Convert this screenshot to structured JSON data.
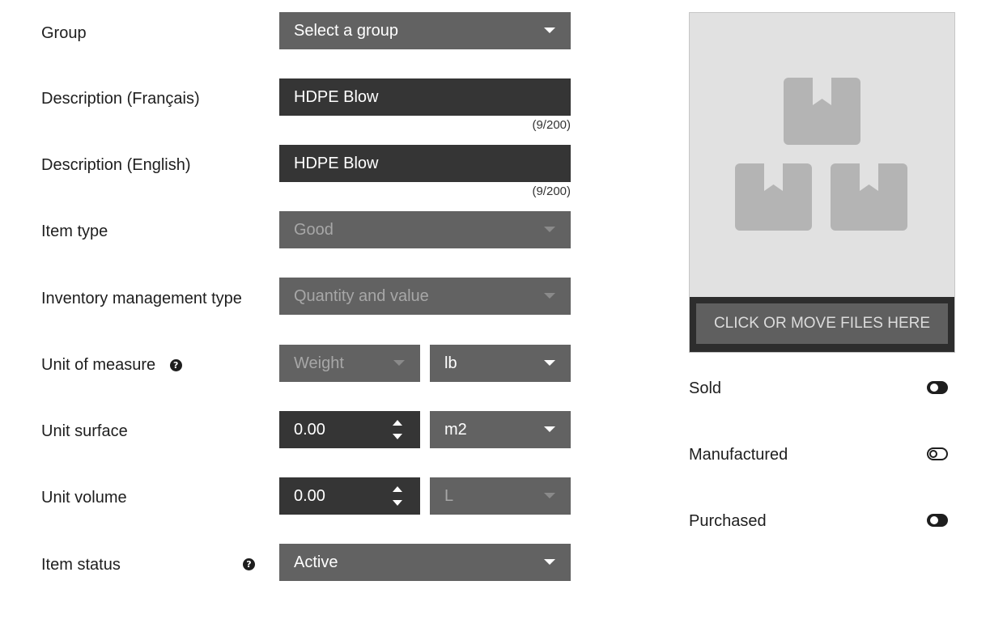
{
  "form": {
    "group": {
      "label": "Group",
      "value": "Select a group"
    },
    "description_fr": {
      "label": "Description (Français)",
      "value": "HDPE Blow",
      "counter": "(9/200)"
    },
    "description_en": {
      "label": "Description (English)",
      "value": "HDPE Blow",
      "counter": "(9/200)"
    },
    "item_type": {
      "label": "Item type",
      "value": "Good"
    },
    "inventory_type": {
      "label": "Inventory management type",
      "value": "Quantity and value"
    },
    "unit_of_measure": {
      "label": "Unit of measure",
      "help": "?",
      "category": "Weight",
      "unit": "lb"
    },
    "unit_surface": {
      "label": "Unit surface",
      "value": "0.00",
      "unit": "m2"
    },
    "unit_volume": {
      "label": "Unit volume",
      "value": "0.00",
      "unit": "L"
    },
    "item_status": {
      "label": "Item status",
      "help": "?",
      "value": "Active"
    }
  },
  "upload": {
    "button_label": "CLICK OR MOVE FILES HERE",
    "placeholder_icon": "boxes-icon"
  },
  "toggles": [
    {
      "label": "Sold",
      "state": "on"
    },
    {
      "label": "Manufactured",
      "state": "off"
    },
    {
      "label": "Purchased",
      "state": "on"
    }
  ],
  "colors": {
    "select_bg": "#626262",
    "input_bg": "#353535",
    "dropzone_bg": "#e1e1e1",
    "placeholder_icon": "#b4b4b4"
  }
}
